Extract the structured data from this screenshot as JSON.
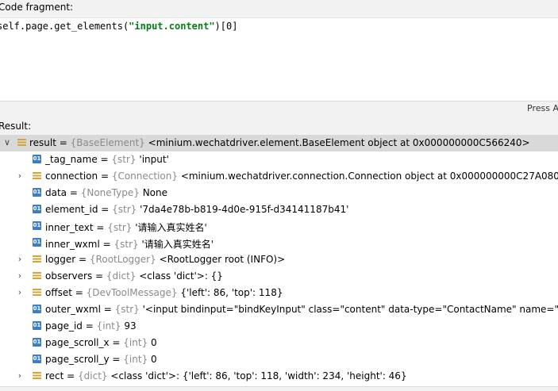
{
  "labels": {
    "code_fragment": "Code fragment:",
    "result": "Result:",
    "hint": "Press A"
  },
  "editor": {
    "code_prefix": "self.page.get_elements(",
    "code_string": "\"input.content\"",
    "code_suffix": ")[0]"
  },
  "tree": {
    "rows": [
      {
        "name": "result",
        "type": "{BaseElement}",
        "value": "<minium.wechatdriver.element.BaseElement object at 0x000000000C566240>",
        "icon": "object",
        "expandable": true,
        "expanded": true
      },
      {
        "name": "_tag_name",
        "type": "{str}",
        "value": "'input'",
        "icon": "field",
        "expandable": false
      },
      {
        "name": "connection",
        "type": "{Connection}",
        "value": "<minium.wechatdriver.connection.Connection object at 0x000000000C27A080>",
        "icon": "object",
        "expandable": true
      },
      {
        "name": "data",
        "type": "{NoneType}",
        "value": "None",
        "icon": "field",
        "expandable": false
      },
      {
        "name": "element_id",
        "type": "{str}",
        "value": "'7da4e78b-b819-4d0e-915f-d34141187b41'",
        "icon": "field",
        "expandable": false
      },
      {
        "name": "inner_text",
        "type": "{str}",
        "value": "'请输入真实姓名'",
        "icon": "field",
        "expandable": false
      },
      {
        "name": "inner_wxml",
        "type": "{str}",
        "value": "'请输入真实姓名'",
        "icon": "field",
        "expandable": false
      },
      {
        "name": "logger",
        "type": "{RootLogger}",
        "value": "<RootLogger root (INFO)>",
        "icon": "object",
        "expandable": true
      },
      {
        "name": "observers",
        "type": "{dict}",
        "value": "<class 'dict'>: {}",
        "icon": "object",
        "expandable": true
      },
      {
        "name": "offset",
        "type": "{DevToolMessage}",
        "value": "{'left': 86, 'top': 118}",
        "icon": "object",
        "expandable": true
      },
      {
        "name": "outer_wxml",
        "type": "{str}",
        "value": "'<input bindinput=\"bindKeyInput\" class=\"content\" data-type=\"ContactName\" name=\"contact",
        "icon": "field",
        "expandable": false
      },
      {
        "name": "page_id",
        "type": "{int}",
        "value": "93",
        "icon": "field",
        "expandable": false
      },
      {
        "name": "page_scroll_x",
        "type": "{int}",
        "value": "0",
        "icon": "field",
        "expandable": false
      },
      {
        "name": "page_scroll_y",
        "type": "{int}",
        "value": "0",
        "icon": "field",
        "expandable": false
      },
      {
        "name": "rect",
        "type": "{dict}",
        "value": "<class 'dict'>: {'left': 86, 'top': 118, 'width': 234, 'height': 46}",
        "icon": "object",
        "expandable": true
      }
    ]
  },
  "icon_names": {
    "field": "field-icon",
    "object": "object-icon",
    "expand": "chevron-right-icon",
    "collapse": "chevron-down-icon"
  },
  "colors": {
    "selected_row": "#d9d9d9",
    "string_literal": "#067d17",
    "type_hint": "#8a8a8a",
    "field_icon": "#3b7ec7",
    "object_icon": "#d7a437"
  }
}
